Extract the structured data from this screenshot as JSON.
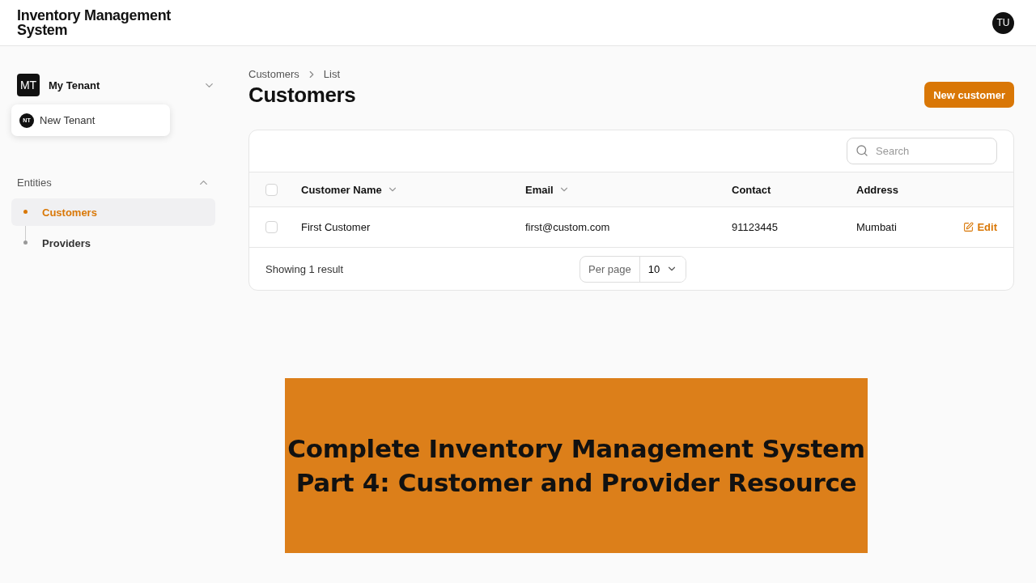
{
  "app": {
    "title": "Inventory Management\nSystem",
    "user_initials": "TU"
  },
  "sidebar": {
    "tenant": {
      "initials": "MT",
      "name": "My Tenant"
    },
    "tenant_menu": [
      {
        "initials": "NT",
        "label": "New Tenant"
      }
    ],
    "group": {
      "label": "Entities",
      "expanded": true,
      "items": [
        {
          "label": "Customers",
          "selected": true
        },
        {
          "label": "Providers",
          "selected": false
        }
      ]
    }
  },
  "breadcrumbs": [
    "Customers",
    "List"
  ],
  "page_title": "Customers",
  "new_button": "New customer",
  "search": {
    "placeholder": "Search"
  },
  "table": {
    "select_all_checked": false,
    "columns": [
      {
        "label": "Customer Name",
        "sortable": true
      },
      {
        "label": "Email",
        "sortable": true
      },
      {
        "label": "Contact",
        "sortable": false
      },
      {
        "label": "Address",
        "sortable": false
      }
    ],
    "rows": [
      {
        "checked": false,
        "cells": [
          "First Customer",
          "first@custom.com",
          "91123445",
          "Mumbati"
        ],
        "action": "Edit"
      }
    ]
  },
  "footer": {
    "summary": "Showing 1 result",
    "per_page_label": "Per page",
    "per_page_value": "10"
  },
  "banner": {
    "lines": [
      "Complete Inventory Management System",
      "Part 4: Customer and Provider Resource"
    ]
  }
}
